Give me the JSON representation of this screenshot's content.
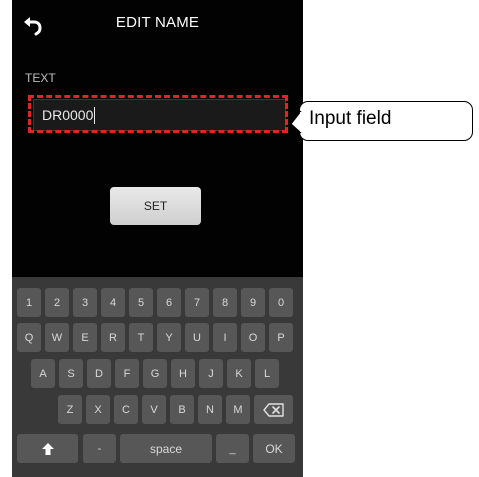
{
  "header": {
    "title": "EDIT NAME",
    "back_icon": "back-arrow-icon"
  },
  "form": {
    "text_label": "TEXT",
    "input_value": "DR0000",
    "set_label": "SET"
  },
  "callout": {
    "label": "Input field"
  },
  "keyboard": {
    "row1": [
      "1",
      "2",
      "3",
      "4",
      "5",
      "6",
      "7",
      "8",
      "9",
      "0"
    ],
    "row2": [
      "Q",
      "W",
      "E",
      "R",
      "T",
      "Y",
      "U",
      "I",
      "O",
      "P"
    ],
    "row3": [
      "A",
      "S",
      "D",
      "F",
      "G",
      "H",
      "J",
      "K",
      "L"
    ],
    "row4": [
      "Z",
      "X",
      "C",
      "V",
      "B",
      "N",
      "M"
    ],
    "backspace_icon": "backspace-icon",
    "shift_icon": "shift-up-arrow-icon",
    "dash": "-",
    "space": "space",
    "underscore": "_",
    "ok": "OK"
  },
  "colors": {
    "highlight": "#e0242b",
    "background": "#020202",
    "keyboard_bg": "#393939",
    "key": "#575757"
  }
}
